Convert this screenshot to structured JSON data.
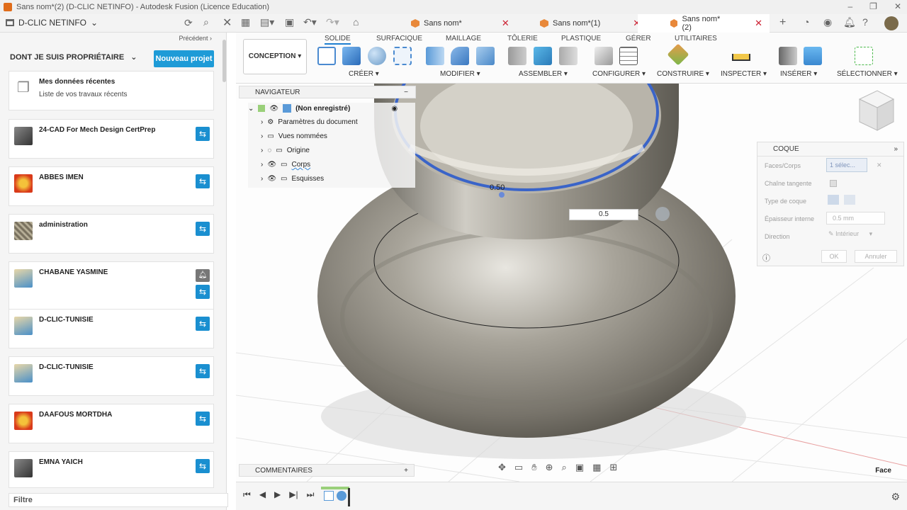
{
  "window": {
    "title": "Sans nom*(2) (D-CLIC NETINFO) - Autodesk Fusion (Licence Education)",
    "controls": [
      "–",
      "❐",
      "✕"
    ]
  },
  "topbar": {
    "team": "D-CLIC NETINFO",
    "tabs": [
      {
        "label": "Sans nom*"
      },
      {
        "label": "Sans nom*(1)"
      },
      {
        "label": "Sans nom*(2)"
      }
    ],
    "add_tab": "+"
  },
  "data_panel": {
    "previous": "Précédent ›",
    "owner_heading": "DONT JE SUIS PROPRIÉTAIRE",
    "new_project": "Nouveau projet",
    "recent": {
      "title": "Mes données récentes",
      "subtitle": "Liste de vos travaux récents"
    },
    "projects": [
      {
        "name": "24-CAD For Mech Design CertPrep"
      },
      {
        "name": "ABBES IMEN"
      },
      {
        "name": "administration"
      },
      {
        "name": "CHABANE YASMINE"
      },
      {
        "name": "D-CLIC-TUNISIE"
      },
      {
        "name": "D-CLIC-TUNISIE"
      },
      {
        "name": "DAAFOUS MORTDHA"
      },
      {
        "name": "EMNA YAICH"
      }
    ],
    "filter": "Filtre"
  },
  "toolbar": {
    "tabs": [
      "SOLIDE",
      "SURFACIQUE",
      "MAILLAGE",
      "TÔLERIE",
      "PLASTIQUE",
      "GÉRER",
      "UTILITAIRES"
    ],
    "workspace": "CONCEPTION ▾",
    "groups": [
      "CRÉER ▾",
      "MODIFIER ▾",
      "ASSEMBLER ▾",
      "CONFIGURER ▾",
      "CONSTRUIRE ▾",
      "INSPECTER ▾",
      "INSÉRER ▾",
      "SÉLECTIONNER ▾"
    ]
  },
  "navigator": {
    "title": "NAVIGATEUR",
    "root": "(Non enregistré)",
    "items": [
      "Paramètres du document",
      "Vues nommées",
      "Origine",
      "Corps",
      "Esquisses"
    ]
  },
  "viewport": {
    "dimension_label": "0.50",
    "input_value": "0.5",
    "view_label": "Face"
  },
  "coque": {
    "title": "COQUE",
    "faces_label": "Faces/Corps",
    "faces_value": "1 sélec...",
    "tangent_label": "Chaîne tangente",
    "type_label": "Type de coque",
    "thickness_label": "Épaisseur interne",
    "thickness_value": "0.5 mm",
    "direction_label": "Direction",
    "direction_value": "Intérieur",
    "ok": "OK",
    "cancel": "Annuler"
  },
  "comments": {
    "title": "COMMENTAIRES"
  },
  "colors": {
    "accent": "#1e9bd7",
    "share": "#1a8fd0",
    "orange": "#e8883a"
  }
}
